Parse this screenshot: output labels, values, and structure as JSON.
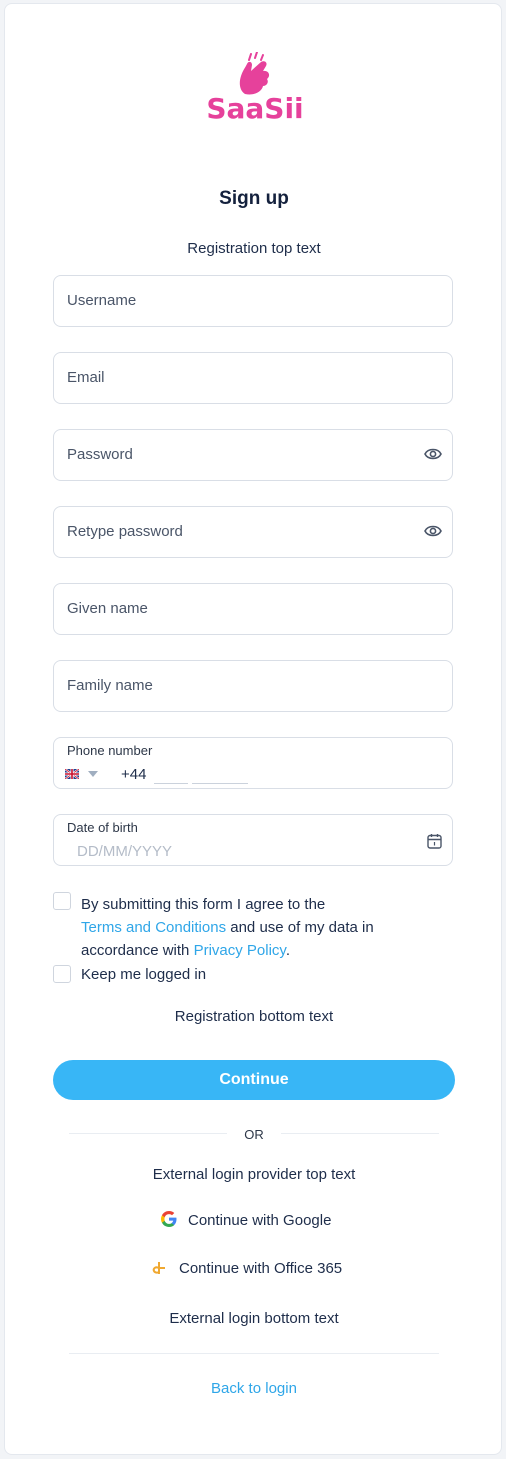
{
  "brand": {
    "name": "SaaSii",
    "color": "#e6419b"
  },
  "heading": {
    "title": "Sign up",
    "top_text": "Registration top text"
  },
  "form": {
    "username": {
      "placeholder": "Username"
    },
    "email": {
      "placeholder": "Email"
    },
    "password": {
      "placeholder": "Password"
    },
    "retype_password": {
      "placeholder": "Retype password"
    },
    "given_name": {
      "placeholder": "Given name"
    },
    "family_name": {
      "placeholder": "Family name"
    },
    "phone": {
      "label": "Phone number",
      "country_code": "+44",
      "country_flag": "uk-flag-icon"
    },
    "dob": {
      "label": "Date of birth",
      "placeholder": "DD/MM/YYYY"
    }
  },
  "consent": {
    "prefix": "By submitting this form I agree to the",
    "terms_link": "Terms and Conditions",
    "middle": "and use of my data in accordance with",
    "privacy_link": "Privacy Policy",
    "suffix": ".",
    "keep_logged_in": "Keep me logged in"
  },
  "bottom_text": "Registration bottom text",
  "continue_label": "Continue",
  "or_label": "OR",
  "external": {
    "top_text": "External login provider top text",
    "google_label": "Continue with Google",
    "office_label": "Continue with Office 365",
    "bottom_text": "External login bottom text"
  },
  "back_to_login": "Back to login",
  "colors": {
    "accent": "#38b6f6",
    "link": "#2fa6e8",
    "brand": "#e6419b"
  }
}
